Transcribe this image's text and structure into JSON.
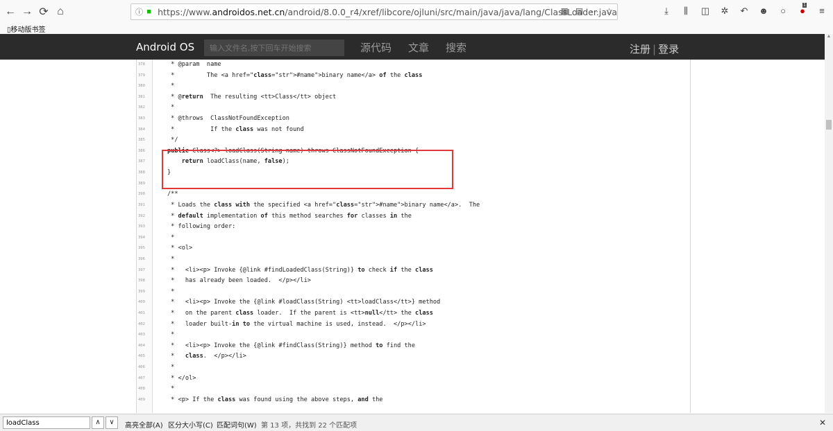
{
  "browser": {
    "back_icon": "←",
    "forward_icon": "→",
    "reload_icon": "⟳",
    "home_icon": "⌂",
    "url_prefix": "https://www.",
    "url_domain": "androidos.net.cn",
    "url_path": "/android/8.0.0_r4/xref/libcore/ojluni/src/main/java/java/lang/ClassLoader.java",
    "bookmark_label": "移动版书签",
    "addon_badge": "1"
  },
  "site": {
    "logo": "Android OS",
    "search_placeholder": "输入文件名,按下回车开始搜索",
    "nav": [
      "源代码",
      "文章",
      "搜索"
    ],
    "register": "注册",
    "separator": "|",
    "login": "登录"
  },
  "code": {
    "lines": [
      {
        "num": "378",
        "text": " * @param  name"
      },
      {
        "num": "379",
        "text": " *         The <a href=\"#name\">binary name</a> of the class"
      },
      {
        "num": "380",
        "text": " *"
      },
      {
        "num": "381",
        "text": " * @return  The resulting <tt>Class</tt> object"
      },
      {
        "num": "382",
        "text": " *"
      },
      {
        "num": "383",
        "text": " * @throws  ClassNotFoundException"
      },
      {
        "num": "384",
        "text": " *          If the class was not found"
      },
      {
        "num": "385",
        "text": " */"
      },
      {
        "num": "386",
        "text": "public Class<?> loadClass(String name) throws ClassNotFoundException {"
      },
      {
        "num": "387",
        "text": "    return loadClass(name, false);"
      },
      {
        "num": "388",
        "text": "}"
      },
      {
        "num": "389",
        "text": ""
      },
      {
        "num": "390",
        "text": "/**"
      },
      {
        "num": "391",
        "text": " * Loads the class with the specified <a href=\"#name\">binary name</a>.  The"
      },
      {
        "num": "392",
        "text": " * default implementation of this method searches for classes in the"
      },
      {
        "num": "393",
        "text": " * following order:"
      },
      {
        "num": "394",
        "text": " *"
      },
      {
        "num": "395",
        "text": " * <ol>"
      },
      {
        "num": "396",
        "text": " *"
      },
      {
        "num": "397",
        "text": " *   <li><p> Invoke {@link #findLoadedClass(String)} to check if the class"
      },
      {
        "num": "398",
        "text": " *   has already been loaded.  </p></li>"
      },
      {
        "num": "399",
        "text": " *"
      },
      {
        "num": "400",
        "text": " *   <li><p> Invoke the {@link #loadClass(String) <tt>loadClass</tt>} method"
      },
      {
        "num": "401",
        "text": " *   on the parent class loader.  If the parent is <tt>null</tt> the class"
      },
      {
        "num": "402",
        "text": " *   loader built-in to the virtual machine is used, instead.  </p></li>"
      },
      {
        "num": "403",
        "text": " *"
      },
      {
        "num": "404",
        "text": " *   <li><p> Invoke the {@link #findClass(String)} method to find the"
      },
      {
        "num": "405",
        "text": " *   class.  </p></li>"
      },
      {
        "num": "406",
        "text": " *"
      },
      {
        "num": "407",
        "text": " * </ol>"
      },
      {
        "num": "408",
        "text": " *"
      },
      {
        "num": "409",
        "text": " * <p> If the class was found using the above steps, and the"
      }
    ]
  },
  "findbar": {
    "query": "loadClass",
    "prev_icon": "∧",
    "next_icon": "∨",
    "highlight_all": "高亮全部(A)",
    "match_case": "区分大小写(C)",
    "whole_words": "匹配词句(W)",
    "status": "第 13 项，共找到 22 个匹配项",
    "close_icon": "✕"
  }
}
